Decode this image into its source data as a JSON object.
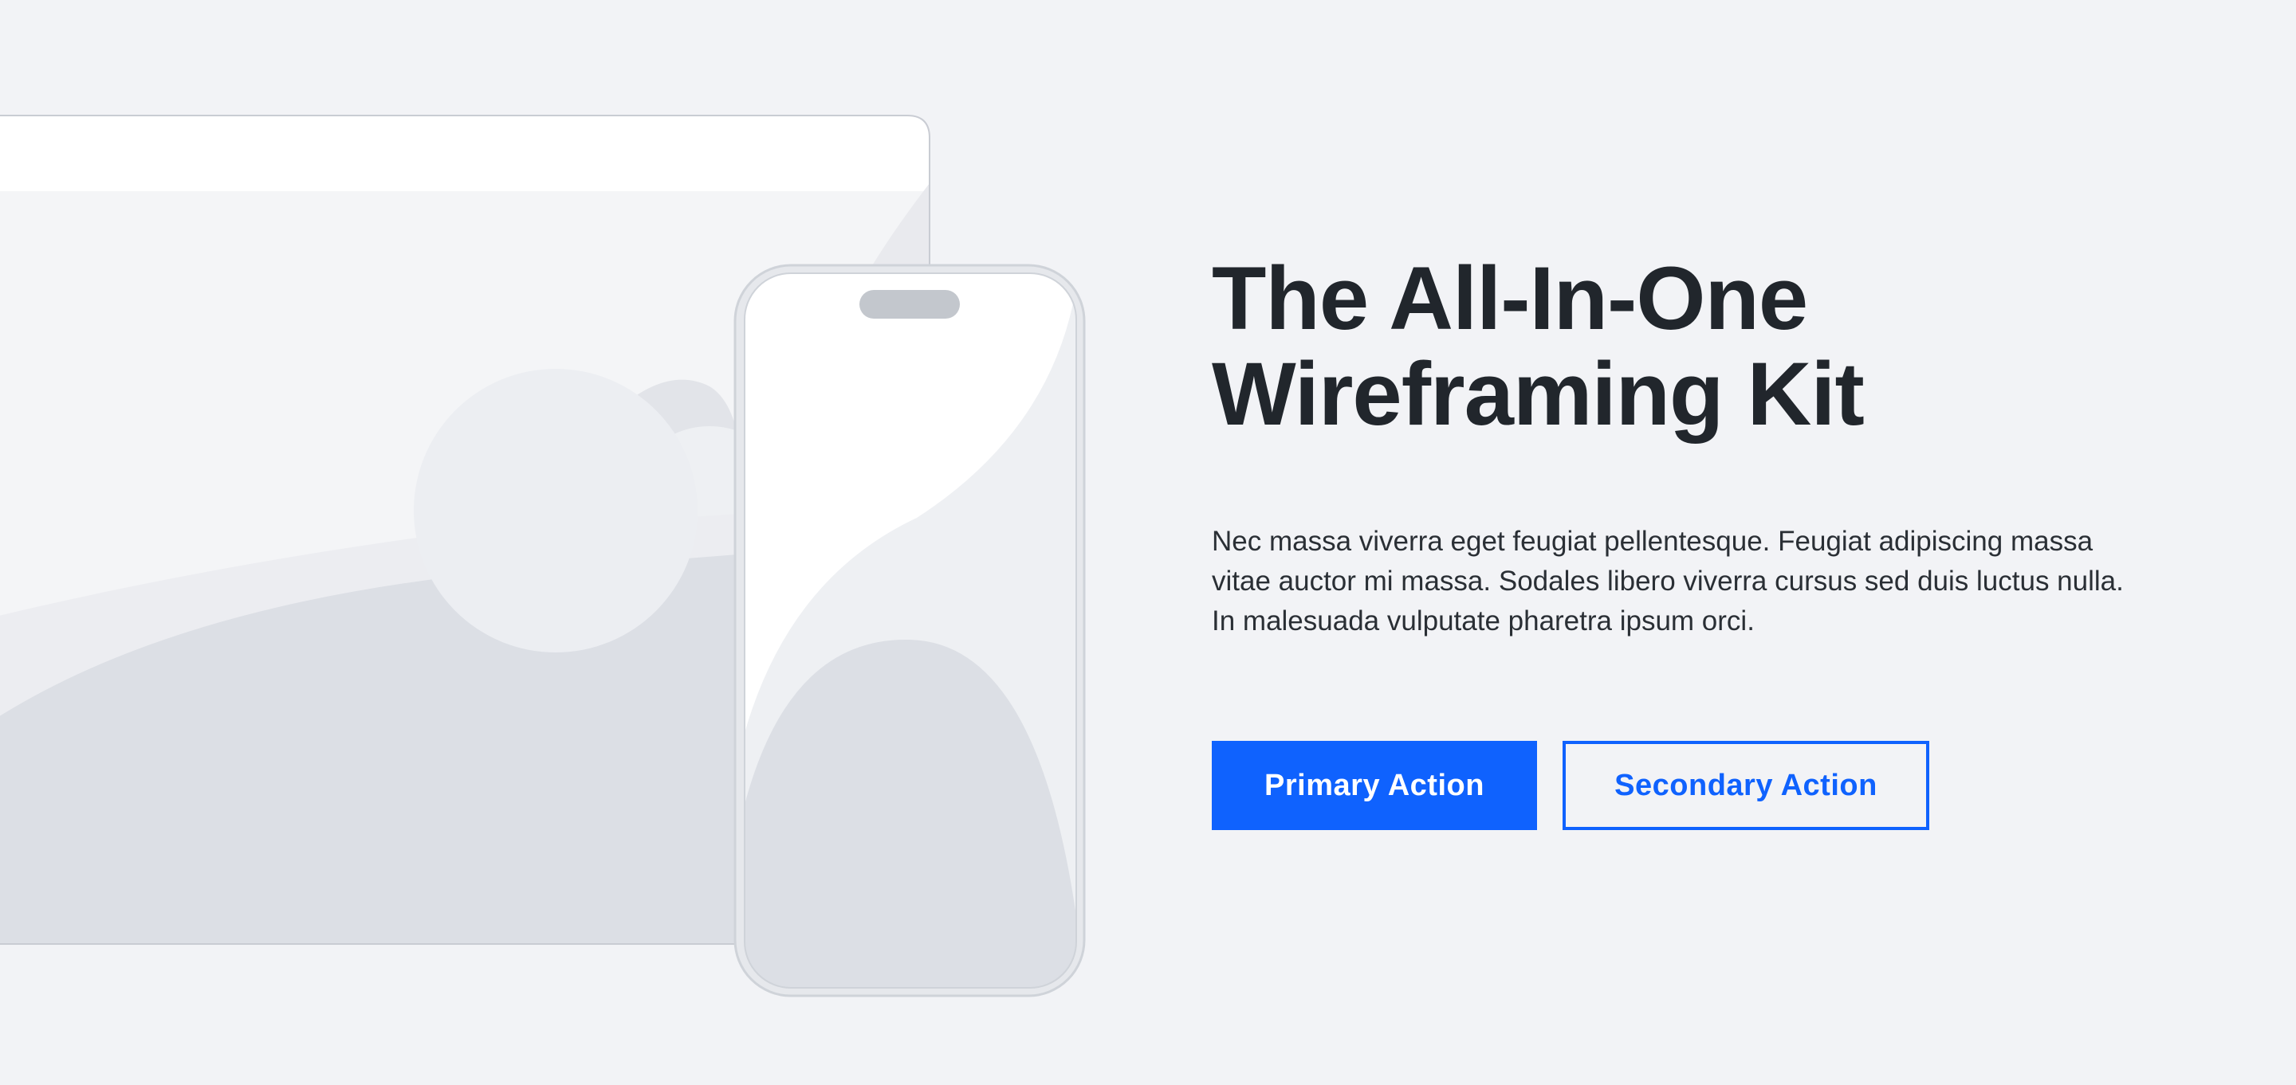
{
  "hero": {
    "headline_line1": "The All-In-One",
    "headline_line2": "Wireframing Kit",
    "body_line1": "Nec massa viverra eget feugiat pellentesque. Feugiat adipiscing massa",
    "body_line2": "vitae auctor mi massa. Sodales libero viverra cursus sed duis luctus nulla.",
    "body_line3": "In malesuada vulputate pharetra ipsum orci.",
    "primary_action": "Primary Action",
    "secondary_action": "Secondary Action"
  },
  "colors": {
    "page_background": "#f2f3f6",
    "accent": "#0f62fe",
    "heading_text": "#21262c",
    "body_text": "#2a2f35",
    "device_frame": "#d7dae0",
    "placeholder_light": "#ecedf1",
    "placeholder_mid": "#dcdfe5"
  }
}
